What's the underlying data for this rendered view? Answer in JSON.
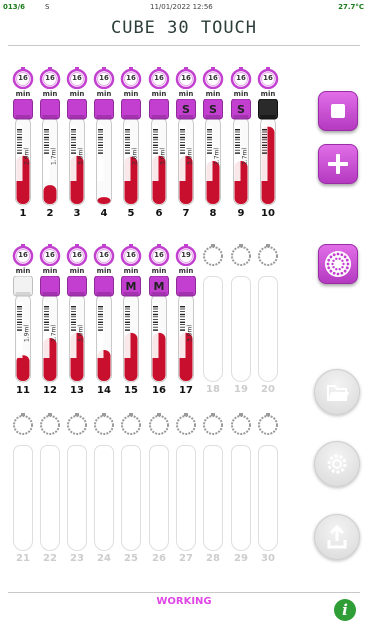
{
  "status": {
    "id": "013/6",
    "s": "S",
    "datetime": "11/01/2022  12:56",
    "temperature": "27.7°C"
  },
  "title": "CUBE 30 TOUCH",
  "timer_unit": "min",
  "footer": {
    "status": "WORKING",
    "info_label": "i"
  },
  "colors": {
    "accent": "#c23fd0",
    "status_ok": "#1a7a1a",
    "blood": "#c8102e",
    "info": "#2f9e36"
  },
  "positions": [
    {
      "num": "1",
      "timer": "16",
      "cap": "purple",
      "volume": "2.9ml",
      "fill": 0.56,
      "letter": ""
    },
    {
      "num": "2",
      "timer": "16",
      "cap": "purple",
      "volume": "1.7ml",
      "fill": 0.22,
      "letter": ""
    },
    {
      "num": "3",
      "timer": "16",
      "cap": "purple",
      "volume": "3.0ml",
      "fill": 0.56,
      "letter": ""
    },
    {
      "num": "4",
      "timer": "16",
      "cap": "purple",
      "volume": "",
      "fill": 0.08,
      "letter": ""
    },
    {
      "num": "5",
      "timer": "16",
      "cap": "purple",
      "volume": "2.8ml",
      "fill": 0.55,
      "letter": ""
    },
    {
      "num": "6",
      "timer": "16",
      "cap": "purple",
      "volume": "3.0ml",
      "fill": 0.56,
      "letter": ""
    },
    {
      "num": "7",
      "timer": "16",
      "cap": "purple",
      "volume": "3.0ml",
      "fill": 0.56,
      "letter": "S"
    },
    {
      "num": "8",
      "timer": "16",
      "cap": "purple",
      "volume": "2.7ml",
      "fill": 0.5,
      "letter": "S"
    },
    {
      "num": "9",
      "timer": "16",
      "cap": "purple",
      "volume": "2.7ml",
      "fill": 0.5,
      "letter": "S"
    },
    {
      "num": "10",
      "timer": "16",
      "cap": "black",
      "volume": "",
      "fill": 0.9,
      "letter": ""
    },
    {
      "num": "11",
      "timer": "16",
      "cap": "white",
      "volume": "1.9ml",
      "fill": 0.3,
      "letter": ""
    },
    {
      "num": "12",
      "timer": "16",
      "cap": "purple",
      "volume": "2.7ml",
      "fill": 0.5,
      "letter": ""
    },
    {
      "num": "13",
      "timer": "16",
      "cap": "purple",
      "volume": "3.0ml",
      "fill": 0.56,
      "letter": ""
    },
    {
      "num": "14",
      "timer": "16",
      "cap": "purple",
      "volume": "",
      "fill": 0.36,
      "letter": ""
    },
    {
      "num": "15",
      "timer": "16",
      "cap": "purple",
      "volume": "",
      "fill": 0.56,
      "letter": "M"
    },
    {
      "num": "16",
      "timer": "16",
      "cap": "purple",
      "volume": "",
      "fill": 0.56,
      "letter": "M"
    },
    {
      "num": "17",
      "timer": "19",
      "cap": "purple",
      "volume": "3.0ml",
      "fill": 0.56,
      "letter": ""
    },
    {
      "num": "18",
      "timer": "",
      "cap": "none",
      "volume": "",
      "fill": 0,
      "letter": ""
    },
    {
      "num": "19",
      "timer": "",
      "cap": "none",
      "volume": "",
      "fill": 0,
      "letter": ""
    },
    {
      "num": "20",
      "timer": "",
      "cap": "none",
      "volume": "",
      "fill": 0,
      "letter": ""
    },
    {
      "num": "21",
      "timer": "",
      "cap": "none",
      "volume": "",
      "fill": 0,
      "letter": ""
    },
    {
      "num": "22",
      "timer": "",
      "cap": "none",
      "volume": "",
      "fill": 0,
      "letter": ""
    },
    {
      "num": "23",
      "timer": "",
      "cap": "none",
      "volume": "",
      "fill": 0,
      "letter": ""
    },
    {
      "num": "24",
      "timer": "",
      "cap": "none",
      "volume": "",
      "fill": 0,
      "letter": ""
    },
    {
      "num": "25",
      "timer": "",
      "cap": "none",
      "volume": "",
      "fill": 0,
      "letter": ""
    },
    {
      "num": "26",
      "timer": "",
      "cap": "none",
      "volume": "",
      "fill": 0,
      "letter": ""
    },
    {
      "num": "27",
      "timer": "",
      "cap": "none",
      "volume": "",
      "fill": 0,
      "letter": ""
    },
    {
      "num": "28",
      "timer": "",
      "cap": "none",
      "volume": "",
      "fill": 0,
      "letter": ""
    },
    {
      "num": "29",
      "timer": "",
      "cap": "none",
      "volume": "",
      "fill": 0,
      "letter": ""
    },
    {
      "num": "30",
      "timer": "",
      "cap": "none",
      "volume": "",
      "fill": 0,
      "letter": ""
    }
  ],
  "side_buttons": [
    {
      "name": "stop-button",
      "icon": "stop-icon"
    },
    {
      "name": "add-button",
      "icon": "plus-icon"
    },
    {
      "name": "rotor-button",
      "icon": "rotor-icon"
    },
    {
      "name": "folder-button",
      "icon": "folder-icon"
    },
    {
      "name": "settings-button",
      "icon": "gear-icon"
    },
    {
      "name": "export-button",
      "icon": "upload-icon"
    }
  ]
}
